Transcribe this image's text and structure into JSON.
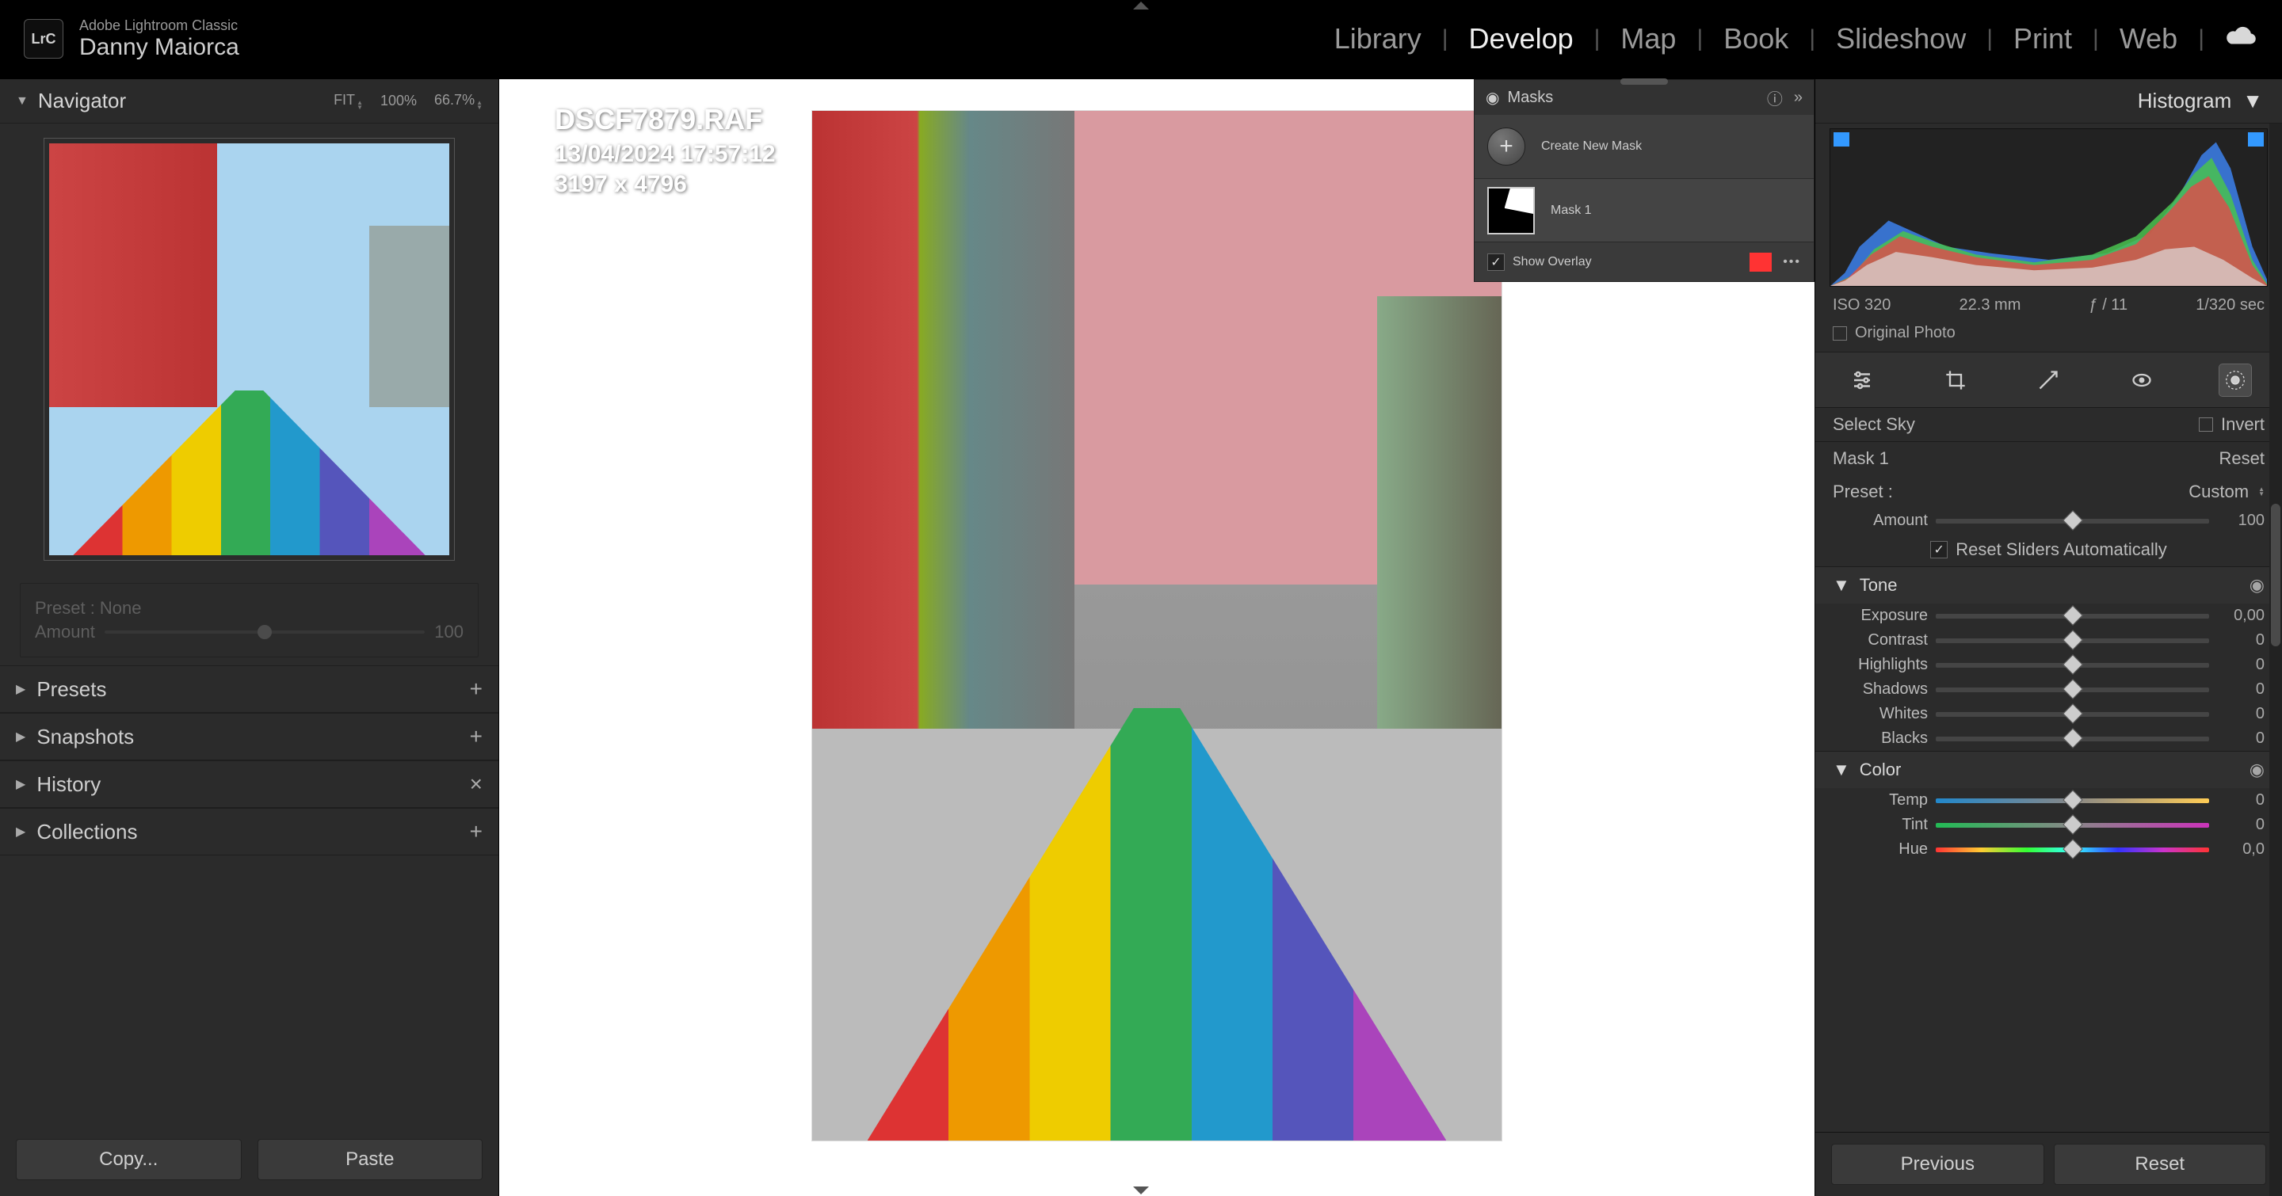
{
  "app": {
    "logo": "LrC",
    "title_small": "Adobe Lightroom Classic",
    "title_big": "Danny Maiorca"
  },
  "topnav": {
    "items": [
      "Library",
      "Develop",
      "Map",
      "Book",
      "Slideshow",
      "Print",
      "Web"
    ],
    "active": "Develop"
  },
  "navigator": {
    "title": "Navigator",
    "fit": "FIT",
    "zoom1": "100%",
    "zoom2": "66.7%"
  },
  "presetBox": {
    "preset_label": "Preset : None",
    "amount_label": "Amount",
    "amount_value": "100"
  },
  "leftSections": [
    {
      "title": "Presets",
      "action": "+"
    },
    {
      "title": "Snapshots",
      "action": "+"
    },
    {
      "title": "History",
      "action": "×"
    },
    {
      "title": "Collections",
      "action": "+"
    }
  ],
  "leftButtons": {
    "copy": "Copy...",
    "paste": "Paste"
  },
  "imageMeta": {
    "filename": "DSCF7879.RAF",
    "datetime": "13/04/2024 17:57:12",
    "dims": "3197 x 4796"
  },
  "masks": {
    "panel_title": "Masks",
    "create": "Create New Mask",
    "mask1": "Mask 1",
    "show_overlay": "Show Overlay",
    "overlay_checked": true,
    "overlay_color": "#ff3333"
  },
  "histogram": {
    "title": "Histogram"
  },
  "exif": {
    "iso": "ISO 320",
    "focal": "22.3 mm",
    "aperture": "ƒ / 11",
    "shutter": "1/320 sec"
  },
  "original": {
    "label": "Original Photo"
  },
  "selectSky": {
    "label": "Select Sky",
    "invert": "Invert"
  },
  "maskRow": {
    "name": "Mask 1",
    "reset": "Reset"
  },
  "presetRow": {
    "label": "Preset :",
    "value": "Custom"
  },
  "amountRow": {
    "label": "Amount",
    "value": "100"
  },
  "resetSliders": {
    "label": "Reset Sliders Automatically"
  },
  "toneHeader": "Tone",
  "toneSliders": [
    {
      "label": "Exposure",
      "value": "0,00"
    },
    {
      "label": "Contrast",
      "value": "0"
    },
    {
      "label": "Highlights",
      "value": "0"
    },
    {
      "label": "Shadows",
      "value": "0"
    },
    {
      "label": "Whites",
      "value": "0"
    },
    {
      "label": "Blacks",
      "value": "0"
    }
  ],
  "colorHeader": "Color",
  "colorSliders": [
    {
      "label": "Temp",
      "value": "0",
      "grad": "temp"
    },
    {
      "label": "Tint",
      "value": "0",
      "grad": "tint"
    },
    {
      "label": "Hue",
      "value": "0,0",
      "grad": "hue"
    }
  ],
  "rightButtons": {
    "previous": "Previous",
    "reset": "Reset"
  }
}
